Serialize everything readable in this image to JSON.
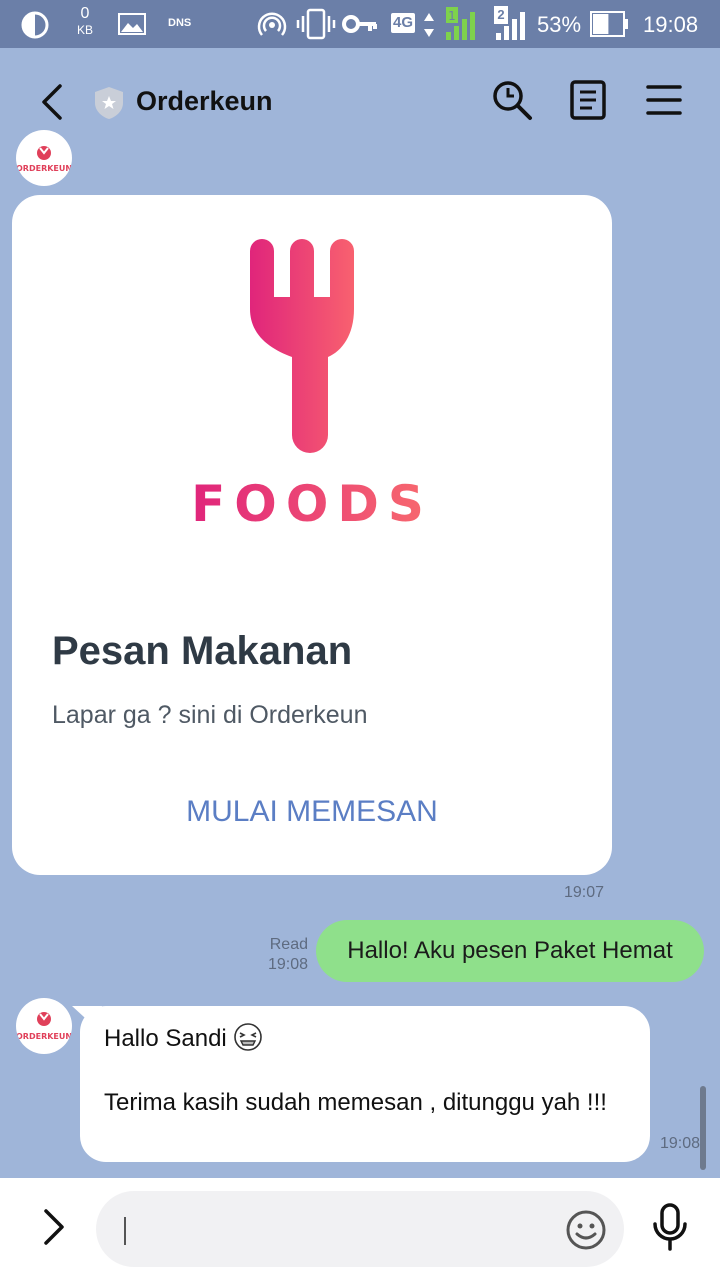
{
  "status_bar": {
    "data_usage_value": "0",
    "data_usage_unit": "KB",
    "dns_label": "DNS",
    "network_type": "4G",
    "sim2_label": "2",
    "battery_percent": "53%",
    "battery_level": 0.53,
    "time": "19:08"
  },
  "header": {
    "title": "Orderkeun",
    "icons": [
      "back-icon",
      "official-shield-icon",
      "search-icon",
      "notes-icon",
      "menu-icon"
    ]
  },
  "chat": {
    "avatar_label": "ORDERKEUN",
    "card": {
      "brand_text": "FOODS",
      "title": "Pesan Makanan",
      "description": "Lapar ga ? sini di Orderkeun",
      "action_label": "MULAI MEMESAN",
      "time": "19:07"
    },
    "sent_message": {
      "text": "Hallo! Aku pesen Paket Hemat",
      "read_label": "Read",
      "time": "19:08"
    },
    "received_message": {
      "line1": "Hallo Sandi",
      "line2": "Terima kasih sudah memesan , ditunggu yah !!!",
      "time": "19:08"
    }
  },
  "input_bar": {
    "message_value": "",
    "icons": [
      "chevron-right-icon",
      "emoji-icon",
      "microphone-icon"
    ]
  },
  "colors": {
    "background": "#9fb5d9",
    "status_bar": "#6b7fa8",
    "sent_bubble": "#8fe08b",
    "brand_pink": "#e83f80",
    "action_blue": "#5b7ec4"
  }
}
